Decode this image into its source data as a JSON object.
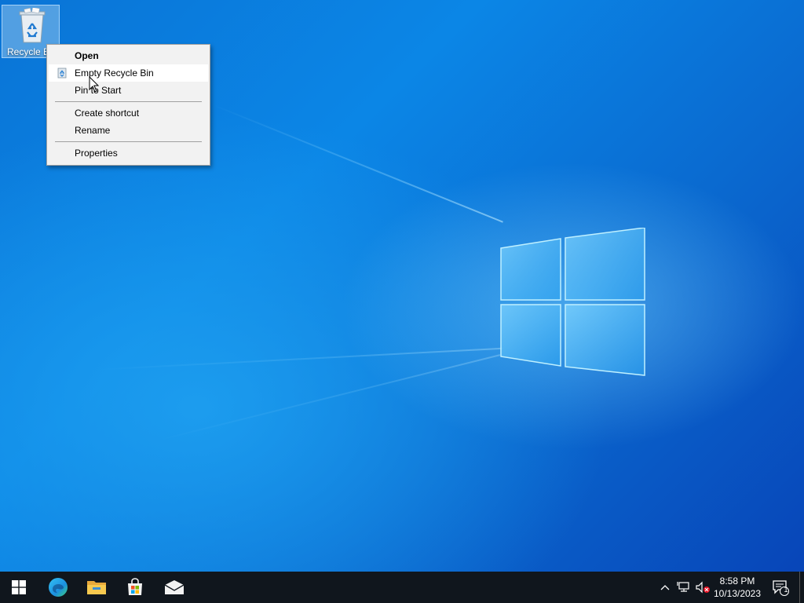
{
  "desktop": {
    "icons": [
      {
        "label": "Recycle Bin",
        "icon": "recycle-bin-icon"
      }
    ]
  },
  "context_menu": {
    "items": [
      {
        "label": "Open",
        "bold": true
      },
      {
        "label": "Empty Recycle Bin",
        "icon": "recycle-icon",
        "highlighted": true
      },
      {
        "label": "Pin to Start"
      },
      {
        "label": "Create shortcut"
      },
      {
        "label": "Rename"
      },
      {
        "label": "Properties"
      }
    ]
  },
  "taskbar": {
    "pinned": [
      {
        "icon": "windows-start-icon"
      },
      {
        "icon": "edge-browser-icon"
      },
      {
        "icon": "file-explorer-icon"
      },
      {
        "icon": "microsoft-store-icon"
      },
      {
        "icon": "mail-icon"
      }
    ],
    "tray": {
      "icons": [
        "chevron-up-icon",
        "network-icon",
        "volume-muted-icon"
      ],
      "time": "8:58 PM",
      "date": "10/13/2023",
      "notification_count": "1"
    }
  },
  "colors": {
    "desktop_blue": "#0a74d6",
    "taskbar": "#10161d",
    "menu_bg": "#f2f2f2",
    "menu_hover": "#ffffff"
  }
}
